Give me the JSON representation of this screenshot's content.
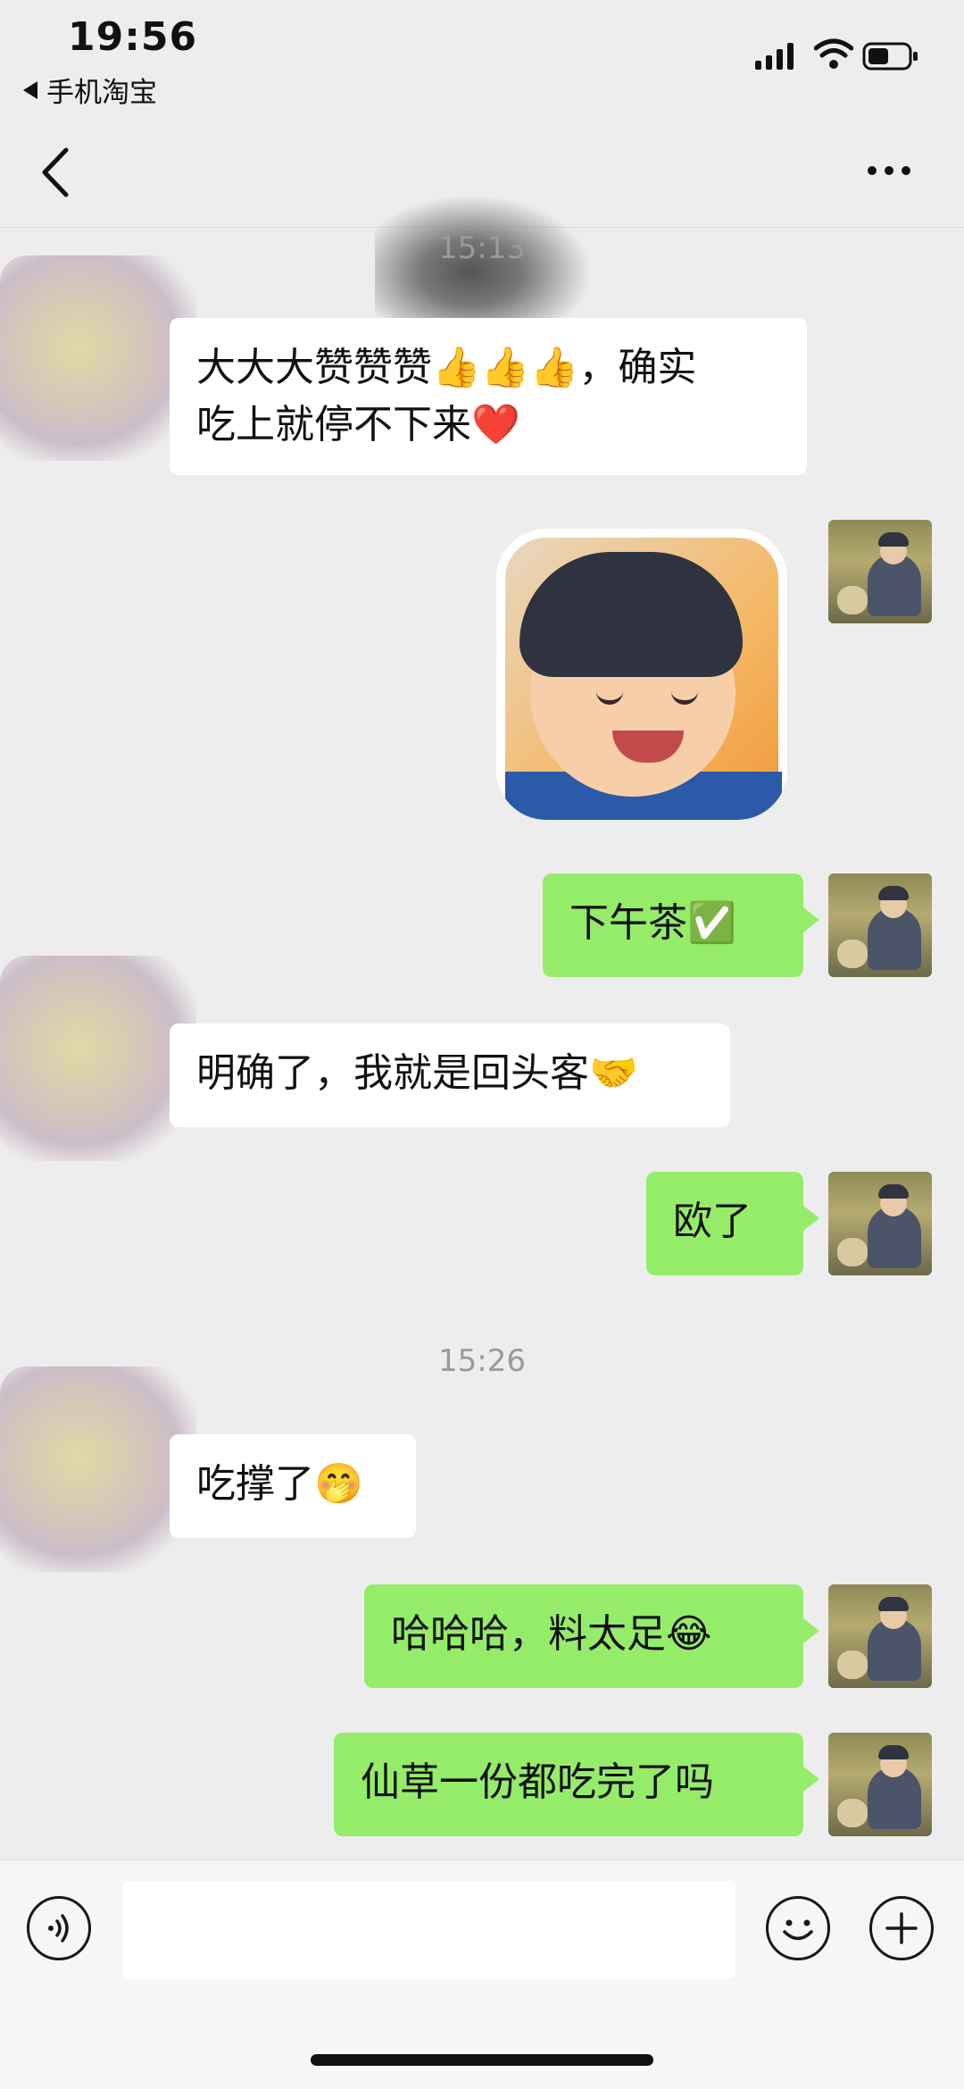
{
  "status_bar": {
    "time": "19:56",
    "back_app": "手机淘宝"
  },
  "messages": [
    {
      "kind": "timestamp",
      "text": "15:13"
    },
    {
      "kind": "incoming",
      "text": "大大大赞赞赞👍👍👍，确实\n吃上就停不下来❤️"
    },
    {
      "kind": "outgoing_sticker",
      "text": ""
    },
    {
      "kind": "outgoing",
      "text": "下午茶✅"
    },
    {
      "kind": "incoming",
      "text": "明确了，我就是回头客🤝"
    },
    {
      "kind": "outgoing",
      "text": "欧了"
    },
    {
      "kind": "timestamp",
      "text": "15:26"
    },
    {
      "kind": "incoming",
      "text": "吃撑了🤭"
    },
    {
      "kind": "outgoing",
      "text": "哈哈哈，料太足😂"
    },
    {
      "kind": "outgoing",
      "text": "仙草一份都吃完了吗"
    }
  ],
  "input": {
    "value": ""
  },
  "colors": {
    "outgoing_bubble": "#95ec69",
    "incoming_bubble": "#ffffff",
    "background": "#ededed"
  },
  "icons": [
    "back-arrow-icon",
    "more-icon",
    "voice-icon",
    "emoji-icon",
    "plus-icon"
  ]
}
